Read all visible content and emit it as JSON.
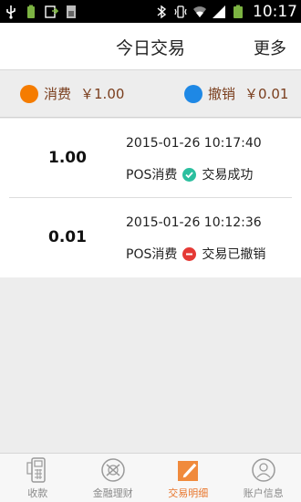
{
  "status_bar": {
    "time": "10:17",
    "icons": [
      "usb-icon",
      "battery-full-icon",
      "sync-icon",
      "sim-card-icon",
      "bluetooth-icon",
      "vibrate-icon",
      "wifi-icon",
      "signal-icon",
      "battery-icon"
    ]
  },
  "header": {
    "title": "今日交易",
    "more_label": "更多"
  },
  "summary": {
    "consume": {
      "label": "消费",
      "amount": "￥1.00",
      "color": "#f57c00"
    },
    "revoke": {
      "label": "撤销",
      "amount": "￥0.01",
      "color": "#1e88e5"
    }
  },
  "transactions": [
    {
      "amount": "1.00",
      "datetime": "2015-01-26 10:17:40",
      "type": "POS消费",
      "status": "交易成功",
      "status_icon": "check-circle-icon",
      "status_color": "#2bbf9f"
    },
    {
      "amount": "0.01",
      "datetime": "2015-01-26 10:12:36",
      "type": "POS消费",
      "status": "交易已撤销",
      "status_icon": "minus-circle-icon",
      "status_color": "#e53935"
    }
  ],
  "bottom_nav": [
    {
      "label": "收款",
      "icon": "pos-terminal-icon",
      "active": false
    },
    {
      "label": "金融理财",
      "icon": "finance-icon",
      "active": false
    },
    {
      "label": "交易明细",
      "icon": "edit-document-icon",
      "active": true
    },
    {
      "label": "账户信息",
      "icon": "user-icon",
      "active": false
    }
  ]
}
